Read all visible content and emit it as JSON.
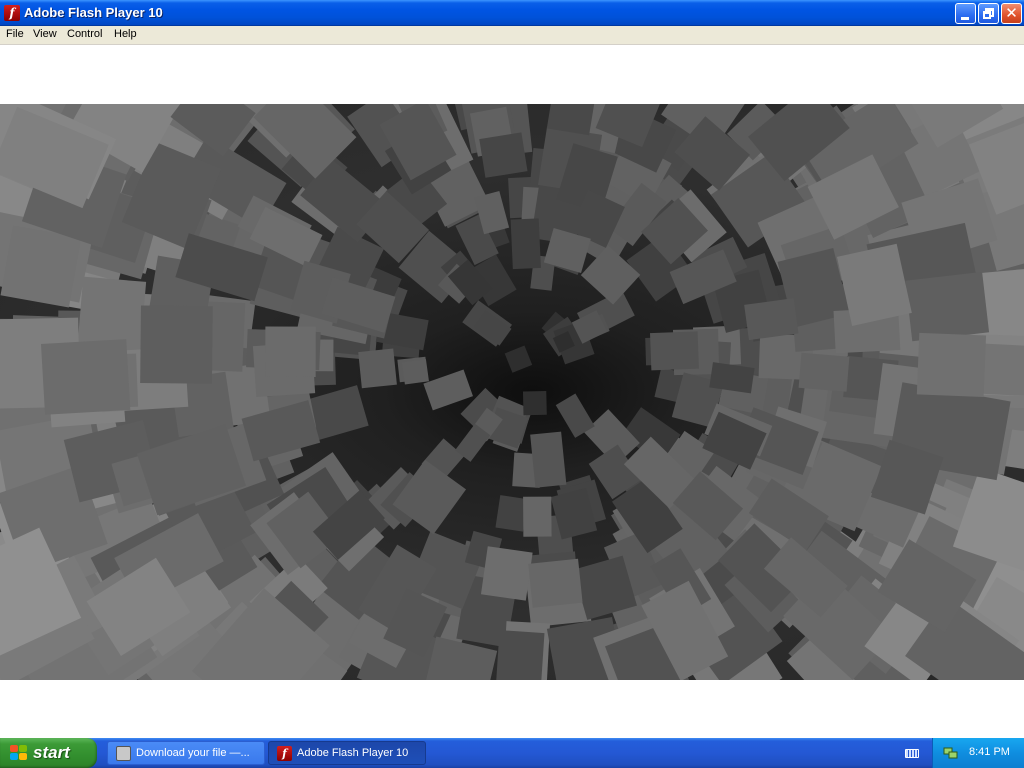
{
  "window": {
    "title": "Adobe Flash Player 10",
    "icon": "flash-player-icon"
  },
  "menu": {
    "items": [
      "File",
      "View",
      "Control",
      "Help"
    ]
  },
  "taskbar": {
    "start_label": "start",
    "tasks": [
      {
        "label": "Download your file —...",
        "icon": "browser-icon",
        "active": false
      },
      {
        "label": "Adobe Flash Player 10",
        "icon": "flash-player-icon",
        "active": true
      }
    ],
    "clock": "8:41 PM"
  },
  "colors": {
    "titlebar": "#0054e3",
    "menubar": "#ece9d8",
    "taskbar": "#245edb",
    "start": "#3c9b37",
    "tray": "#0f8ee0"
  }
}
